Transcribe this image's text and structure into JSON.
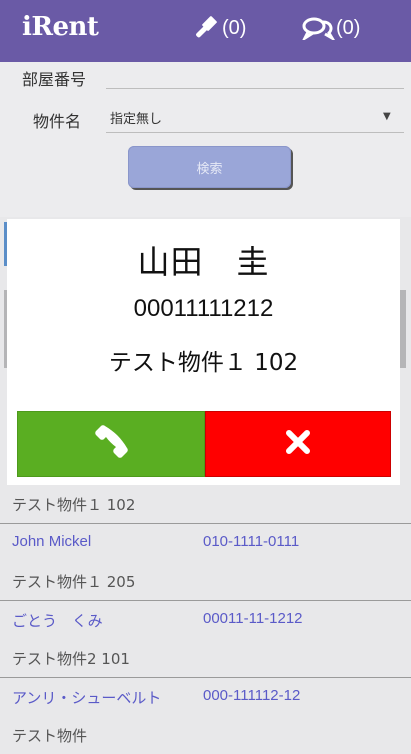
{
  "header": {
    "brand": "iRent",
    "auction_count": "(0)",
    "chat_count": "(0)",
    "icons": [
      "gavel-icon",
      "chat-bubbles-icon"
    ]
  },
  "search_form": {
    "room_number_label": "部屋番号",
    "property_label": "物件名",
    "property_selected": "指定無し",
    "search_button": "検索"
  },
  "call_dialog": {
    "name": "山田　圭",
    "phone": "00011111212",
    "property": "テスト物件１ 102",
    "call_icon": "phone-icon",
    "cancel_icon": "close-icon"
  },
  "contact_list": [
    {
      "property": "テスト物件１ 102"
    },
    {
      "name": "John Mickel",
      "tel": "010-1111-0111",
      "property": "テスト物件１ 205"
    },
    {
      "name": "ごとう　くみ",
      "tel": "00011-11-1212",
      "property": "テスト物件2 101"
    },
    {
      "name": "アンリ・シューベルト",
      "tel": "000-111112-12",
      "property": "テスト物件"
    }
  ],
  "colors": {
    "header": "#6a5aa6",
    "call_button": "#5aae22",
    "cancel_button": "#ff0000",
    "link": "#5a5ac8",
    "search_button": "#9aa6d8"
  }
}
